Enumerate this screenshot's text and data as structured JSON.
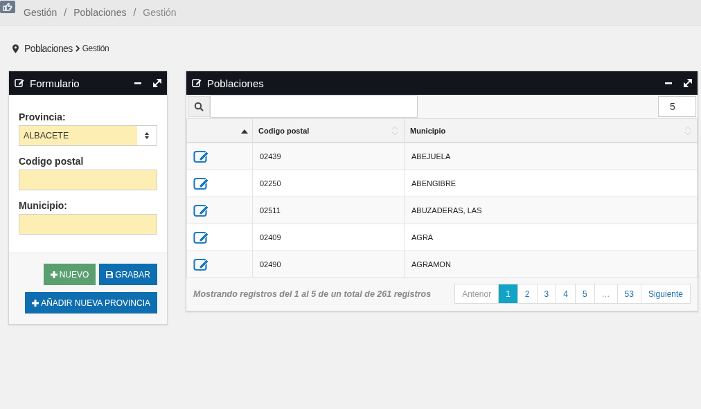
{
  "breadcrumb": [
    {
      "label": "Gestión"
    },
    {
      "separator": "/",
      "label": "Poblaciones"
    },
    {
      "separator": "/",
      "label": "Gestión"
    }
  ],
  "page_path": {
    "section": "Poblaciones",
    "current": "Gestión"
  },
  "form_panel": {
    "title": "Formulario",
    "fields": [
      {
        "kind": "select",
        "label": "Provincia:",
        "value": "ALBACETE"
      },
      {
        "kind": "text",
        "label": "Codigo postal"
      },
      {
        "kind": "text",
        "label": "Municipio:"
      }
    ],
    "buttons": [
      {
        "label": "NUEVO",
        "kind": "success"
      },
      {
        "label": "GRABAR",
        "kind": "primary"
      },
      {
        "label": "AÑADIR NUEVA PROVINCIA",
        "kind": "primary"
      }
    ]
  },
  "table_panel": {
    "title": "Poblaciones",
    "page_size": "5",
    "columns": [
      {
        "label": "Codigo postal"
      },
      {
        "label": "Municipio"
      }
    ],
    "rows": [
      {
        "codigo_postal": "02439",
        "municipio": "ABEJUELA"
      },
      {
        "codigo_postal": "02250",
        "municipio": "ABENGIBRE"
      },
      {
        "codigo_postal": "02511",
        "municipio": "ABUZADERAS, LAS"
      },
      {
        "codigo_postal": "02409",
        "municipio": "AGRA"
      },
      {
        "codigo_postal": "02490",
        "municipio": "AGRAMON"
      }
    ],
    "info": "Mostrando registros del 1 al 5 de un total de 261 registros",
    "pagination": [
      {
        "label": "Anterior",
        "selected": false,
        "disabled": true
      },
      {
        "label": "1",
        "selected": true,
        "disabled": false
      },
      {
        "label": "2",
        "selected": false,
        "disabled": false
      },
      {
        "label": "3",
        "selected": false,
        "disabled": false
      },
      {
        "label": "4",
        "selected": false,
        "disabled": false
      },
      {
        "label": "5",
        "selected": false,
        "disabled": false
      },
      {
        "label": "…",
        "selected": false,
        "disabled": true
      },
      {
        "label": "53",
        "selected": false,
        "disabled": false
      },
      {
        "label": "Siguiente",
        "selected": false,
        "disabled": false
      }
    ]
  }
}
